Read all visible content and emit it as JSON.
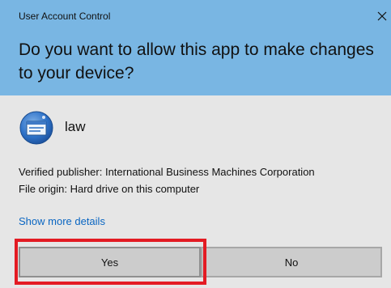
{
  "window": {
    "title": "User Account Control",
    "question": "Do you want to allow this app to make changes to your device?"
  },
  "app": {
    "name": "law",
    "icon": "app-window-icon"
  },
  "info": {
    "publisher": "Verified publisher: International Business Machines Corporation",
    "origin": "File origin: Hard drive on this computer"
  },
  "links": {
    "details": "Show more details"
  },
  "buttons": {
    "yes": "Yes",
    "no": "No"
  },
  "colors": {
    "header": "#79b6e3",
    "body": "#e6e6e6",
    "link": "#0a66c2",
    "highlight": "#e31b23"
  }
}
